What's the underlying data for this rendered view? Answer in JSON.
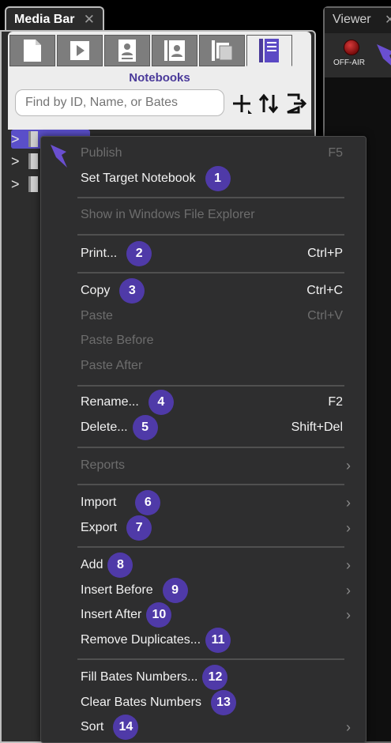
{
  "media_bar": {
    "tab_label": "Media Bar",
    "close_glyph": "✕",
    "section_title": "Notebooks",
    "search_placeholder": "Find by ID, Name, or Bates"
  },
  "viewer": {
    "tab_label": "Viewer",
    "close_glyph": "✕",
    "status_label": "OFF-AIR"
  },
  "menu": {
    "publish": {
      "label": "Publish",
      "shortcut": "F5"
    },
    "set_target": {
      "label": "Set Target Notebook",
      "badge": "1"
    },
    "show_explorer": {
      "label": "Show in Windows File Explorer"
    },
    "print": {
      "label": "Print...",
      "badge": "2",
      "shortcut": "Ctrl+P"
    },
    "copy": {
      "label": "Copy",
      "badge": "3",
      "shortcut": "Ctrl+C"
    },
    "paste": {
      "label": "Paste",
      "shortcut": "Ctrl+V"
    },
    "paste_before": {
      "label": "Paste Before"
    },
    "paste_after": {
      "label": "Paste After"
    },
    "rename": {
      "label": "Rename...",
      "badge": "4",
      "shortcut": "F2"
    },
    "delete": {
      "label": "Delete...",
      "badge": "5",
      "shortcut": "Shift+Del"
    },
    "reports": {
      "label": "Reports"
    },
    "import": {
      "label": "Import",
      "badge": "6"
    },
    "export": {
      "label": "Export",
      "badge": "7"
    },
    "add": {
      "label": "Add",
      "badge": "8"
    },
    "insert_before": {
      "label": "Insert Before",
      "badge": "9"
    },
    "insert_after": {
      "label": "Insert After",
      "badge": "10"
    },
    "remove_duplicates": {
      "label": "Remove Duplicates...",
      "badge": "11"
    },
    "fill_bates": {
      "label": "Fill Bates Numbers...",
      "badge": "12"
    },
    "clear_bates": {
      "label": "Clear Bates Numbers",
      "badge": "13"
    },
    "sort": {
      "label": "Sort",
      "badge": "14"
    },
    "submenu_arrow": "›"
  },
  "colors": {
    "badge": "#4f3aa8",
    "accent_title": "#4a3a9a",
    "selection": "#5a4fc9"
  }
}
